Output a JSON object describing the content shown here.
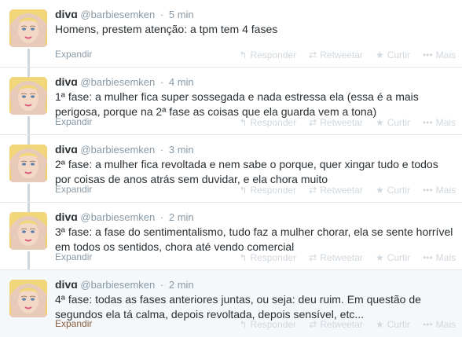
{
  "tweets": [
    {
      "name": "divɑ",
      "handle": "@barbiesemken",
      "dot": "·",
      "time": "5 min",
      "text": "Homens, prestem atenção: a tpm tem 4 fases",
      "expand": "Expandir"
    },
    {
      "name": "divɑ",
      "handle": "@barbiesemken",
      "dot": "·",
      "time": "4 min",
      "text": "1ª fase: a mulher fica super sossegada e nada estressa ela (essa é a mais perigosa, porque na 2ª fase as coisas que ela guarda vem a tona)",
      "expand": "Expandir"
    },
    {
      "name": "divɑ",
      "handle": "@barbiesemken",
      "dot": "·",
      "time": "3 min",
      "text": "2ª fase: a mulher fica revoltada e nem sabe o porque, quer xingar tudo e todos por coisas de anos atrás sem duvidar, e ela chora muito",
      "expand": "Expandir"
    },
    {
      "name": "divɑ",
      "handle": "@barbiesemken",
      "dot": "·",
      "time": "2 min",
      "text": "3ª fase: a fase do sentimentalismo, tudo faz a mulher chorar, ela se sente horrível em todos os sentidos, chora até vendo comercial",
      "expand": "Expandir"
    },
    {
      "name": "divɑ",
      "handle": "@barbiesemken",
      "dot": "·",
      "time": "2 min",
      "text": "4ª fase: todas as fases anteriores juntas, ou seja: deu ruim. Em questão de segundos ela tá calma, depois revoltada, depois sensível, etc...",
      "expand": "Expandir"
    }
  ],
  "actions": {
    "reply": "Responder",
    "retweet": "Retweetar",
    "favorite": "Curtir",
    "more": "Mais"
  },
  "icons": {
    "reply": "reply-arrow-icon",
    "retweet": "retweet-arrows-icon",
    "favorite": "star-icon",
    "more": "ellipsis-icon"
  },
  "colors": {
    "name": "#292f33",
    "meta": "#8899a6",
    "action_faded": "#d0d8de",
    "thread_line": "#ccd6dd",
    "expanded_link": "#8b5c3c"
  }
}
